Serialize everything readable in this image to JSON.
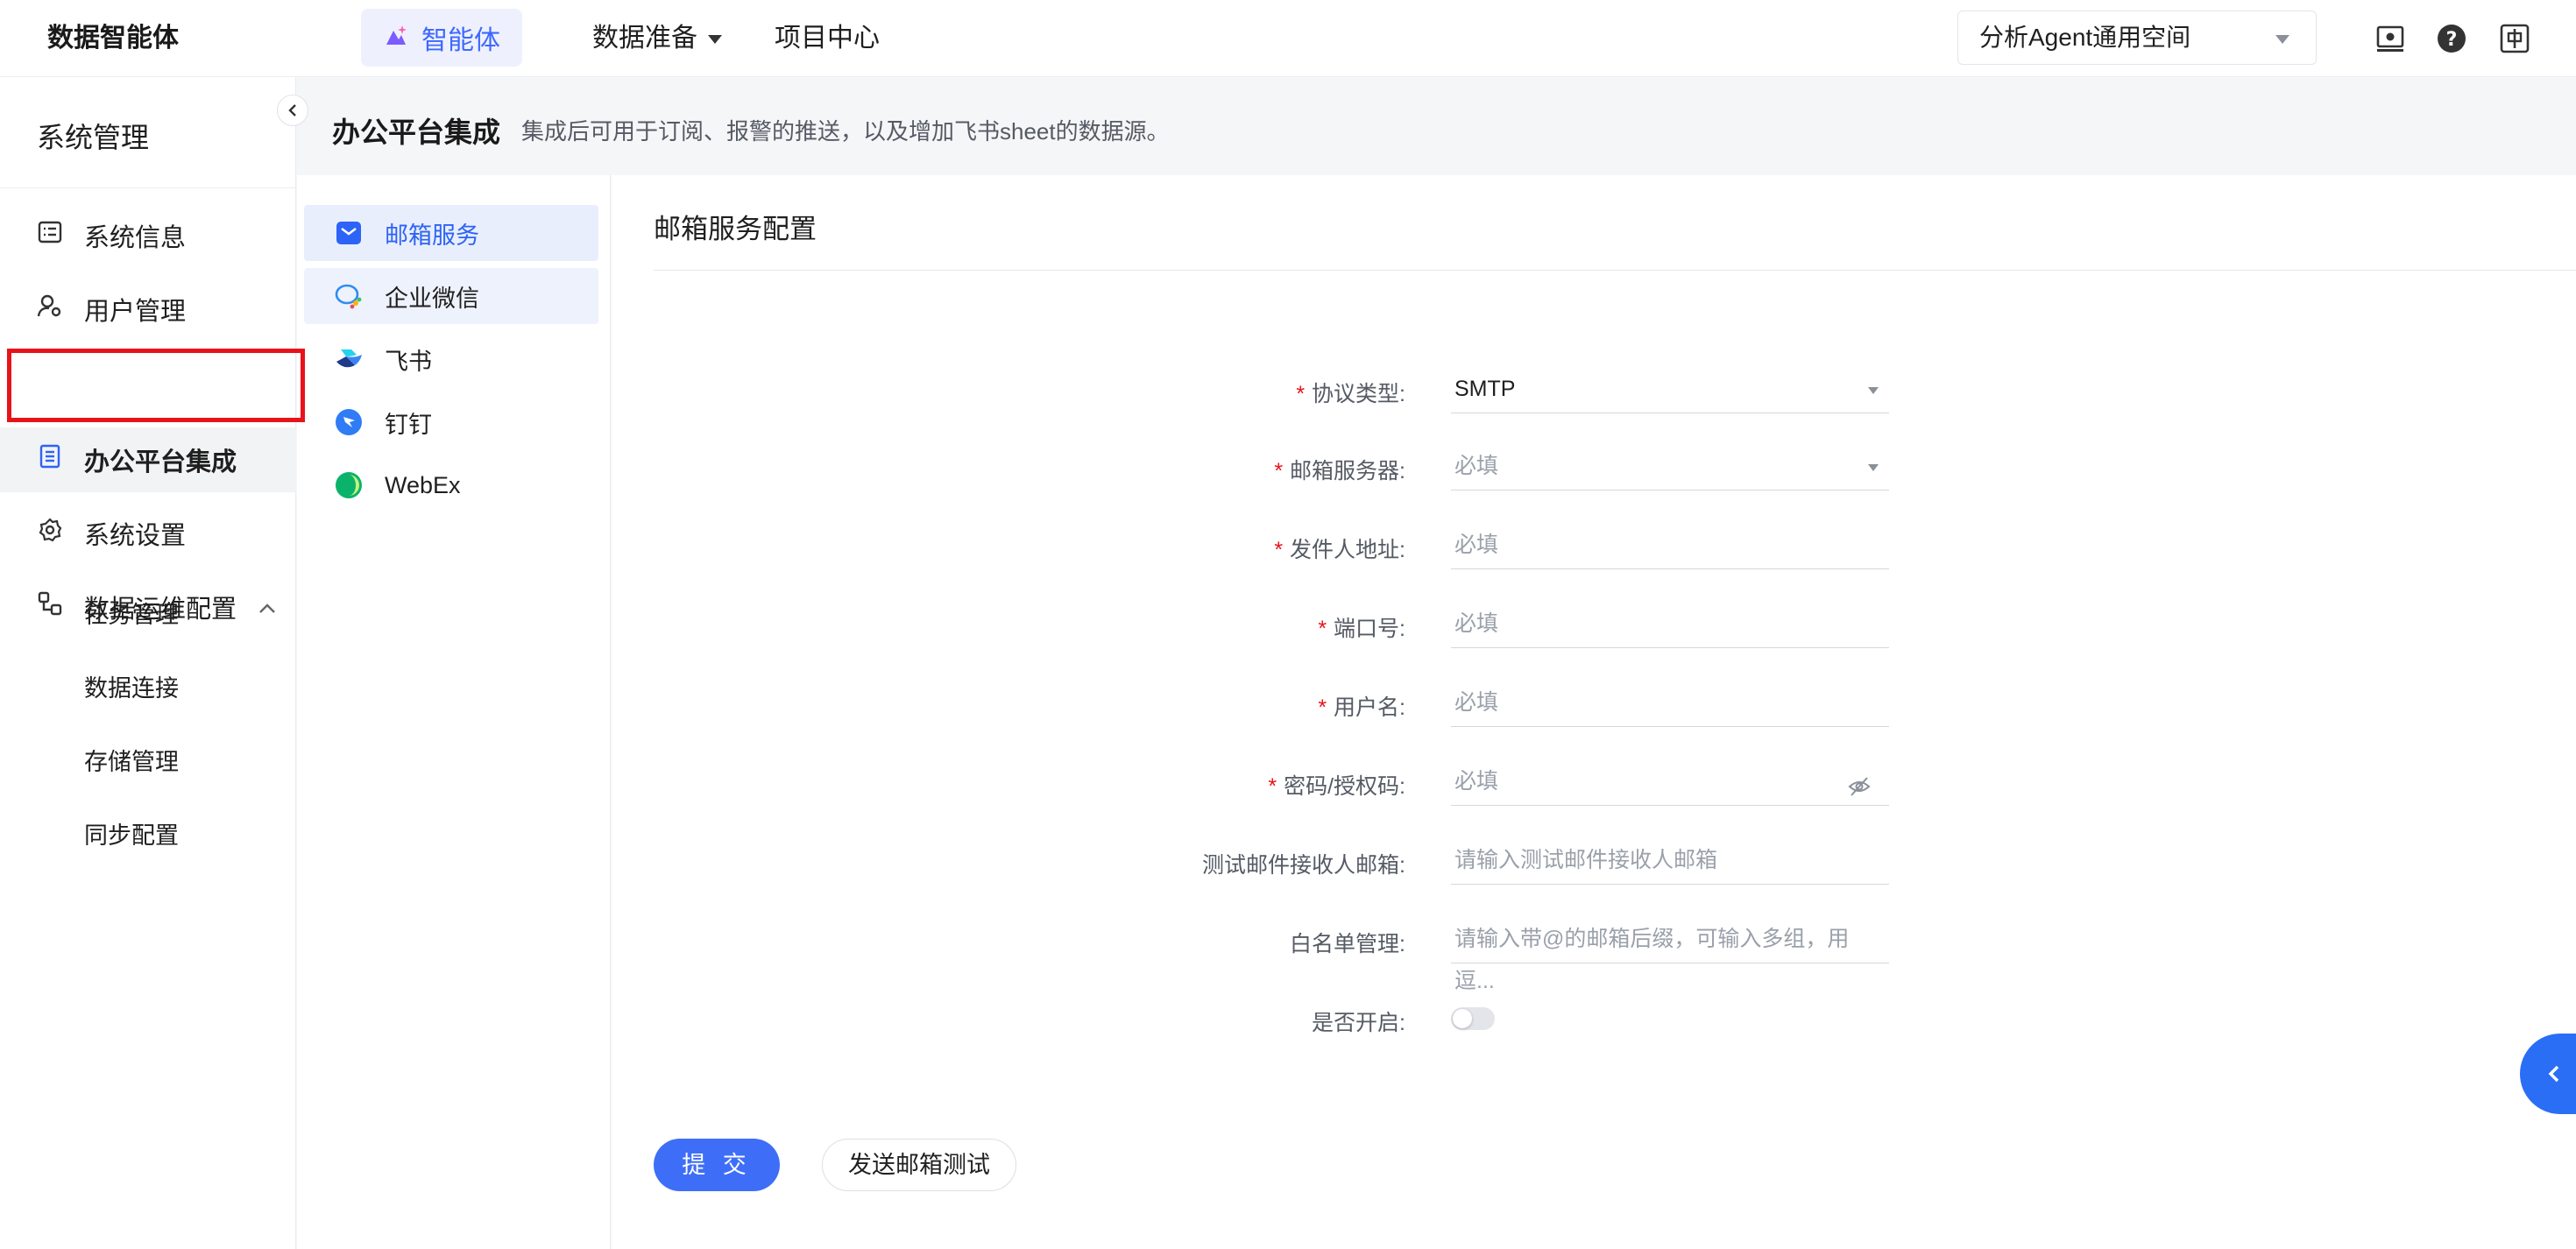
{
  "brand": "数据智能体",
  "topnav": {
    "agent": "智能体",
    "data_prep": "数据准备",
    "project_center": "项目中心"
  },
  "workspace": "分析Agent通用空间",
  "colors": {
    "accent": "#3e6ef8",
    "highlight_red": "#e8131a",
    "active_bg": "#e8eefc"
  },
  "sidebar": {
    "title": "系统管理",
    "items": [
      {
        "label": "系统信息",
        "icon": "info-list-icon"
      },
      {
        "label": "用户管理",
        "icon": "user-gear-icon"
      },
      {
        "label": "办公平台集成",
        "icon": "office-doc-icon"
      },
      {
        "label": "系统设置",
        "icon": "gear-icon"
      },
      {
        "label": "数据运维配置",
        "icon": "data-ops-icon"
      }
    ],
    "subitems": [
      "任务管理",
      "数据连接",
      "存储管理",
      "同步配置"
    ]
  },
  "page": {
    "title": "办公平台集成",
    "desc": "集成后可用于订阅、报警的推送，以及增加飞书sheet的数据源。"
  },
  "subnav": [
    "邮箱服务",
    "企业微信",
    "飞书",
    "钉钉",
    "WebEx"
  ],
  "form": {
    "title": "邮箱服务配置",
    "fields": [
      {
        "label": "协议类型:",
        "required": "*",
        "value": "SMTP"
      },
      {
        "label": "邮箱服务器:",
        "required": "*",
        "placeholder": "必填"
      },
      {
        "label": "发件人地址:",
        "required": "*",
        "placeholder": "必填"
      },
      {
        "label": "端口号:",
        "required": "*",
        "placeholder": "必填"
      },
      {
        "label": "用户名:",
        "required": "*",
        "placeholder": "必填"
      },
      {
        "label": "密码/授权码:",
        "required": "*",
        "placeholder": "必填"
      },
      {
        "label": "测试邮件接收人邮箱:",
        "placeholder": "请输入测试邮件接收人邮箱"
      },
      {
        "label": "白名单管理:",
        "placeholder": "请输入带@的邮箱后缀，可输入多组，用逗..."
      },
      {
        "label": "是否开启:",
        "enabled": false
      }
    ],
    "submit": "提 交",
    "test": "发送邮箱测试"
  }
}
